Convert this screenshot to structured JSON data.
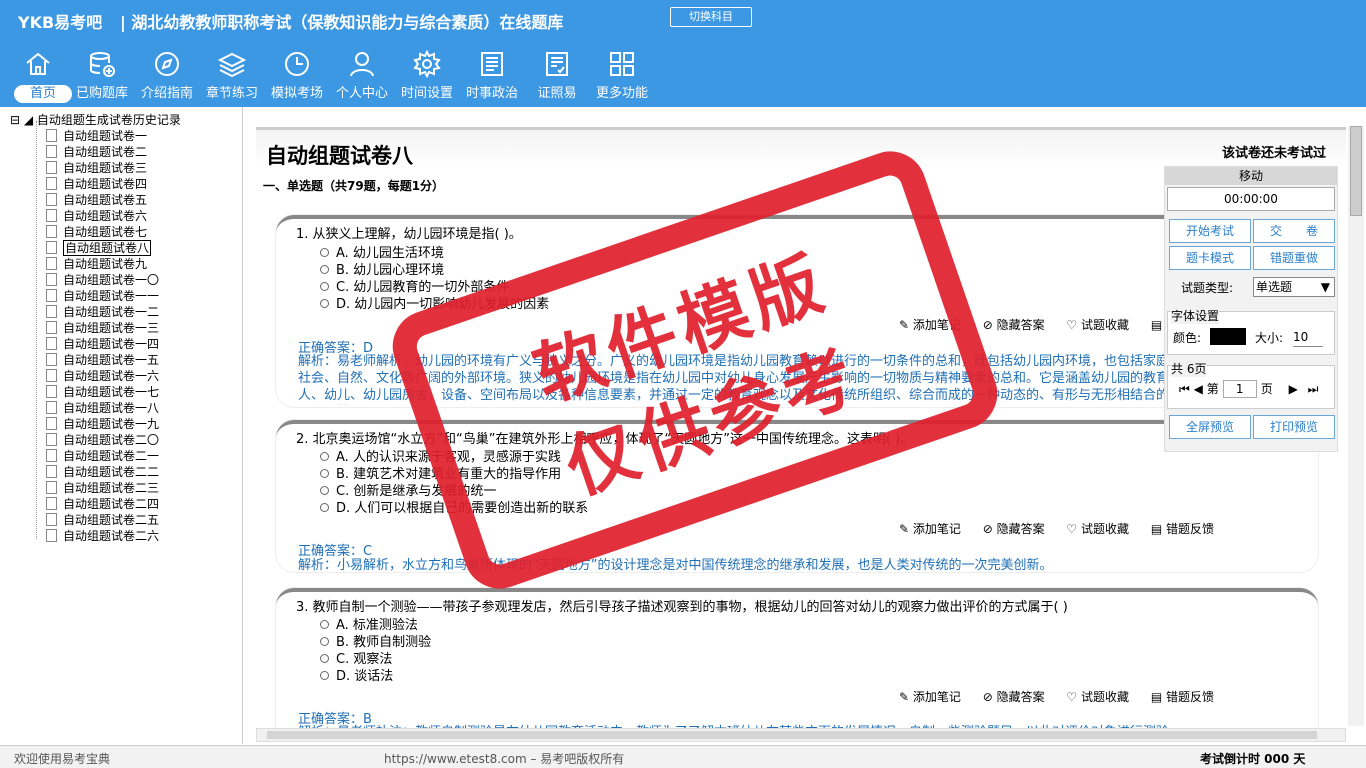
{
  "header": {
    "logo": "YKB易考吧",
    "title": "湖北幼教教师职称考试（保教知识能力与综合素质）在线题库",
    "switch_label": "切换科目"
  },
  "nav": [
    {
      "label": "首页",
      "icon": "home-icon"
    },
    {
      "label": "已购题库",
      "icon": "database-icon"
    },
    {
      "label": "介绍指南",
      "icon": "compass-icon"
    },
    {
      "label": "章节练习",
      "icon": "layers-icon"
    },
    {
      "label": "模拟考场",
      "icon": "clock-icon"
    },
    {
      "label": "个人中心",
      "icon": "user-icon"
    },
    {
      "label": "时间设置",
      "icon": "gear-icon"
    },
    {
      "label": "时事政治",
      "icon": "news-icon"
    },
    {
      "label": "证照易",
      "icon": "certificate-icon"
    },
    {
      "label": "更多功能",
      "icon": "grid-icon"
    }
  ],
  "tree": {
    "root": "自动组题生成试卷历史记录",
    "items": [
      "自动组题试卷一",
      "自动组题试卷二",
      "自动组题试卷三",
      "自动组题试卷四",
      "自动组题试卷五",
      "自动组题试卷六",
      "自动组题试卷七",
      "自动组题试卷八",
      "自动组题试卷九",
      "自动组题试卷一〇",
      "自动组题试卷一一",
      "自动组题试卷一二",
      "自动组题试卷一三",
      "自动组题试卷一四",
      "自动组题试卷一五",
      "自动组题试卷一六",
      "自动组题试卷一七",
      "自动组题试卷一八",
      "自动组题试卷一九",
      "自动组题试卷二〇",
      "自动组题试卷二一",
      "自动组题试卷二二",
      "自动组题试卷二三",
      "自动组题试卷二四",
      "自动组题试卷二五",
      "自动组题试卷二六"
    ],
    "selected_index": 7
  },
  "paper": {
    "title": "自动组题试卷八",
    "status": "该试卷还未考试过",
    "section": "一、单选题（共79题，每题1分）"
  },
  "tools": [
    "添加笔记",
    "隐藏答案",
    "试题收藏",
    "错题反馈"
  ],
  "questions": [
    {
      "text": "1. 从狭义上理解，幼儿园环境是指(  )。",
      "options": [
        "A. 幼儿园生活环境",
        "B. 幼儿园心理环境",
        "C. 幼儿园教育的一切外部条件",
        "D. 幼儿园内一切影响幼儿发展的因素"
      ],
      "answer": "正确答案：D",
      "explanation": "解析：易老师解析：幼儿园的环境有广义与狭义之分。广义的幼儿园环境是指幼儿园教育赖以进行的一切条件的总和，既包括幼儿园内环境，也包括家庭、社会、自然、文化等广阔的外部环境。狭义的幼儿园环境是指在幼儿园中对幼儿身心发展产生影响的一切物质与精神要素的总和。它是涵盖幼儿园的教育成人、幼儿、幼儿园房舍、设备、空间布局以及各种信息要素，并通过一定的教育观念以及文化传统所组织、综合而成的一种动态的、有形与无形相结合的教育空间范围。"
    },
    {
      "text": "2. 北京奥运场馆“水立方”和“鸟巢”在建筑外形上相呼应，体现了“天圆地方”这一中国传统理念。这表明(  )。",
      "options": [
        "A. 人的认识来源于客观，灵感源于实践",
        "B. 建筑艺术对建筑业有重大的指导作用",
        "C. 创新是继承与发展的统一",
        "D. 人们可以根据自己的需要创造出新的联系"
      ],
      "answer": "正确答案：C",
      "explanation": "解析：小易解析，水立方和鸟巢所体现的“天圆地方”的设计理念是对中国传统理念的继承和发展，也是人类对传统的一次完美创新。"
    },
    {
      "text": "3. 教师自制一个测验——带孩子参观理发店，然后引导孩子描述观察到的事物，根据幼儿的回答对幼儿的观察力做出评价的方式属于(  )",
      "options": [
        "A. 标准测验法",
        "B. 教师自制测验",
        "C. 观察法",
        "D. 谈话法"
      ],
      "answer": "正确答案：B",
      "explanation": "解析：易老师补注：教师自制测验是在幼儿园教育活动中，教师为了了解本班幼儿在某些方面的发展情况，自制一些测验题目，以此对评价对象进行测验。"
    }
  ],
  "panel": {
    "move": "移动",
    "timer": "00:00:00",
    "buttons": [
      "开始考试",
      "交　　卷",
      "题卡模式",
      "错题重做"
    ],
    "type_label": "试题类型:",
    "type_value": "单选题",
    "font_title": "字体设置",
    "color_label": "颜色:",
    "size_label": "大小:",
    "size_value": "10",
    "pages_title": "共 6页",
    "page_prefix": "第",
    "page_value": "1",
    "page_suffix": "页",
    "bottom_buttons": [
      "全屏预览",
      "打印预览"
    ]
  },
  "stamp": {
    "line1": "软件模版",
    "line2": "仅供参考"
  },
  "status": {
    "welcome": "欢迎使用易考宝典",
    "copyright": "https://www.etest8.com – 易考吧版权所有",
    "countdown": "考试倒计时 000 天"
  },
  "colors": {
    "header": "#3d98e3",
    "accent": "#1f6fb6",
    "stamp": "#e0202c"
  }
}
